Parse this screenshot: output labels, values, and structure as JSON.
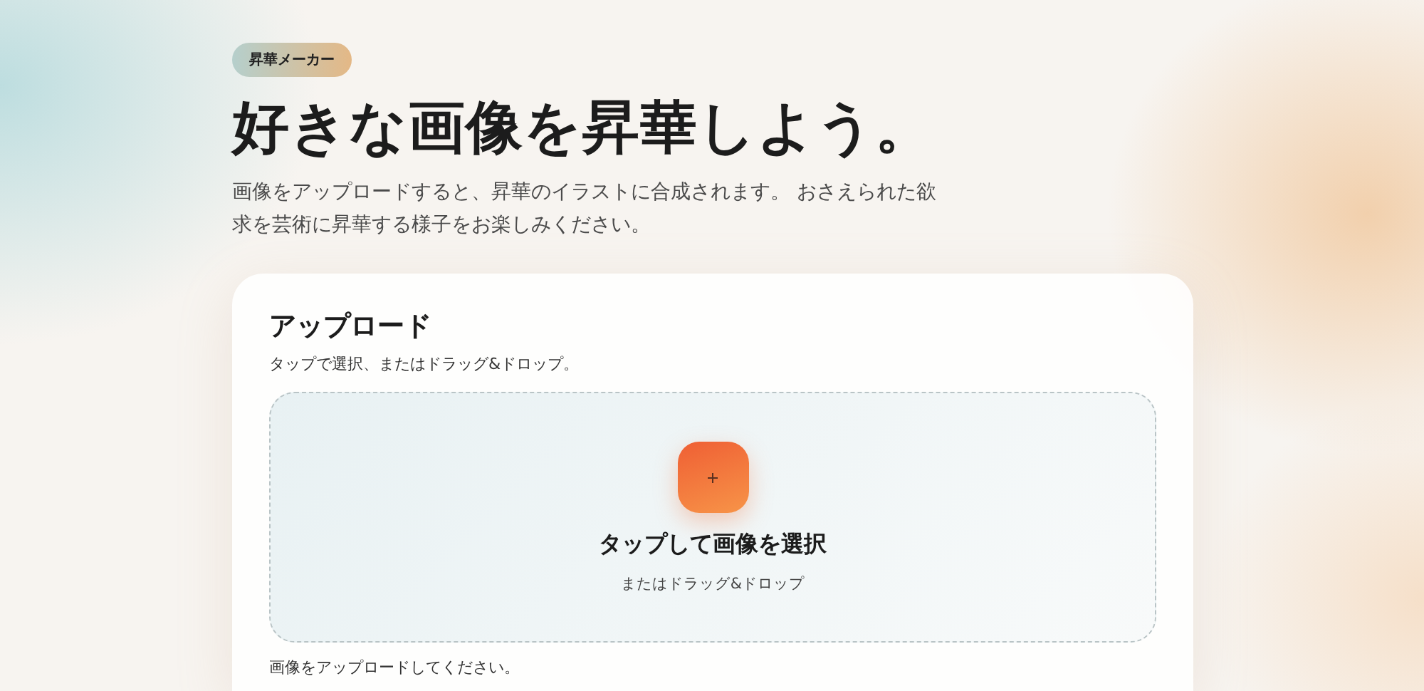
{
  "badge": "昇華メーカー",
  "headline": "好きな画像を昇華しよう。",
  "description": "画像をアップロードすると、昇華のイラストに合成されます。 おさえられた欲求を芸術に昇華する様子をお楽しみください。",
  "upload_card": {
    "title": "アップロード",
    "subtitle": "タップで選択、またはドラッグ&ドロップ。",
    "dropzone": {
      "label": "タップして画像を選択",
      "hint": "またはドラッグ&ドロップ"
    },
    "status": "画像をアップロードしてください。"
  }
}
